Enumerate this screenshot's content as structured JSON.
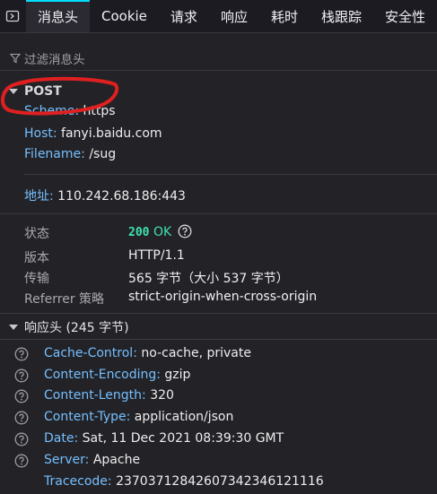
{
  "tabs": [
    {
      "label": "消息头",
      "active": true
    },
    {
      "label": "Cookie",
      "active": false
    },
    {
      "label": "请求",
      "active": false
    },
    {
      "label": "响应",
      "active": false
    },
    {
      "label": "耗时",
      "active": false
    },
    {
      "label": "栈跟踪",
      "active": false
    },
    {
      "label": "安全性",
      "active": false
    }
  ],
  "filter": {
    "placeholder": "过滤消息头"
  },
  "request": {
    "method": "POST",
    "scheme_key": "Scheme:",
    "scheme_val": "https",
    "host_key": "Host:",
    "host_val": "fanyi.baidu.com",
    "filename_key": "Filename:",
    "filename_val": "/sug",
    "address_key": "地址:",
    "address_val": "110.242.68.186:443"
  },
  "summary": {
    "status_label": "状态",
    "status_code": "200",
    "status_text": "OK",
    "version_label": "版本",
    "version_val": "HTTP/1.1",
    "transfer_label": "传输",
    "transfer_val": "565 字节（大小 537 字节）",
    "referrer_label": "Referrer 策略",
    "referrer_val": "strict-origin-when-cross-origin"
  },
  "response_headers": {
    "title": "响应头 (245 字节)",
    "items": [
      {
        "key": "Cache-Control:",
        "value": "no-cache, private",
        "help": true
      },
      {
        "key": "Content-Encoding:",
        "value": "gzip",
        "help": true
      },
      {
        "key": "Content-Length:",
        "value": "320",
        "help": true
      },
      {
        "key": "Content-Type:",
        "value": "application/json",
        "help": true
      },
      {
        "key": "Date:",
        "value": "Sat, 11 Dec 2021 08:39:30 GMT",
        "help": true
      },
      {
        "key": "Server:",
        "value": "Apache",
        "help": true
      },
      {
        "key": "Tracecode:",
        "value": "23703712842607342346121116",
        "help": false
      }
    ]
  },
  "colors": {
    "accent": "#00ddff",
    "key": "#75bfff",
    "status_ok": "#3fe1b0",
    "annotation": "#e02020"
  }
}
